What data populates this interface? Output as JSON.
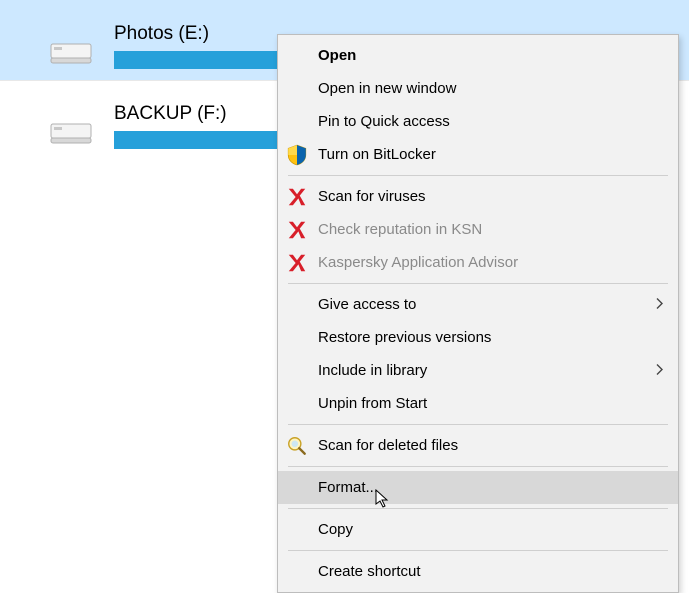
{
  "drives": [
    {
      "label": "Photos (E:)",
      "selected": true,
      "fillPercent": 100
    },
    {
      "label": "BACKUP (F:)",
      "selected": false,
      "fillPercent": 100
    }
  ],
  "context_menu": {
    "items": {
      "open": "Open",
      "open_new_window": "Open in new window",
      "pin_quick_access": "Pin to Quick access",
      "bitlocker": "Turn on BitLocker",
      "scan_viruses": "Scan for viruses",
      "check_ksn": "Check reputation in KSN",
      "kaspersky_advisor": "Kaspersky Application Advisor",
      "give_access": "Give access to",
      "restore_versions": "Restore previous versions",
      "include_library": "Include in library",
      "unpin_start": "Unpin from Start",
      "scan_deleted": "Scan for deleted files",
      "format": "Format...",
      "copy": "Copy",
      "create_shortcut": "Create shortcut"
    }
  },
  "icons": {
    "drive": "drive-icon",
    "shield": "shield-icon",
    "kaspersky": "kaspersky-icon",
    "magnifier": "magnifier-icon",
    "chevron_right": "chevron-right-icon",
    "cursor": "cursor-icon"
  }
}
